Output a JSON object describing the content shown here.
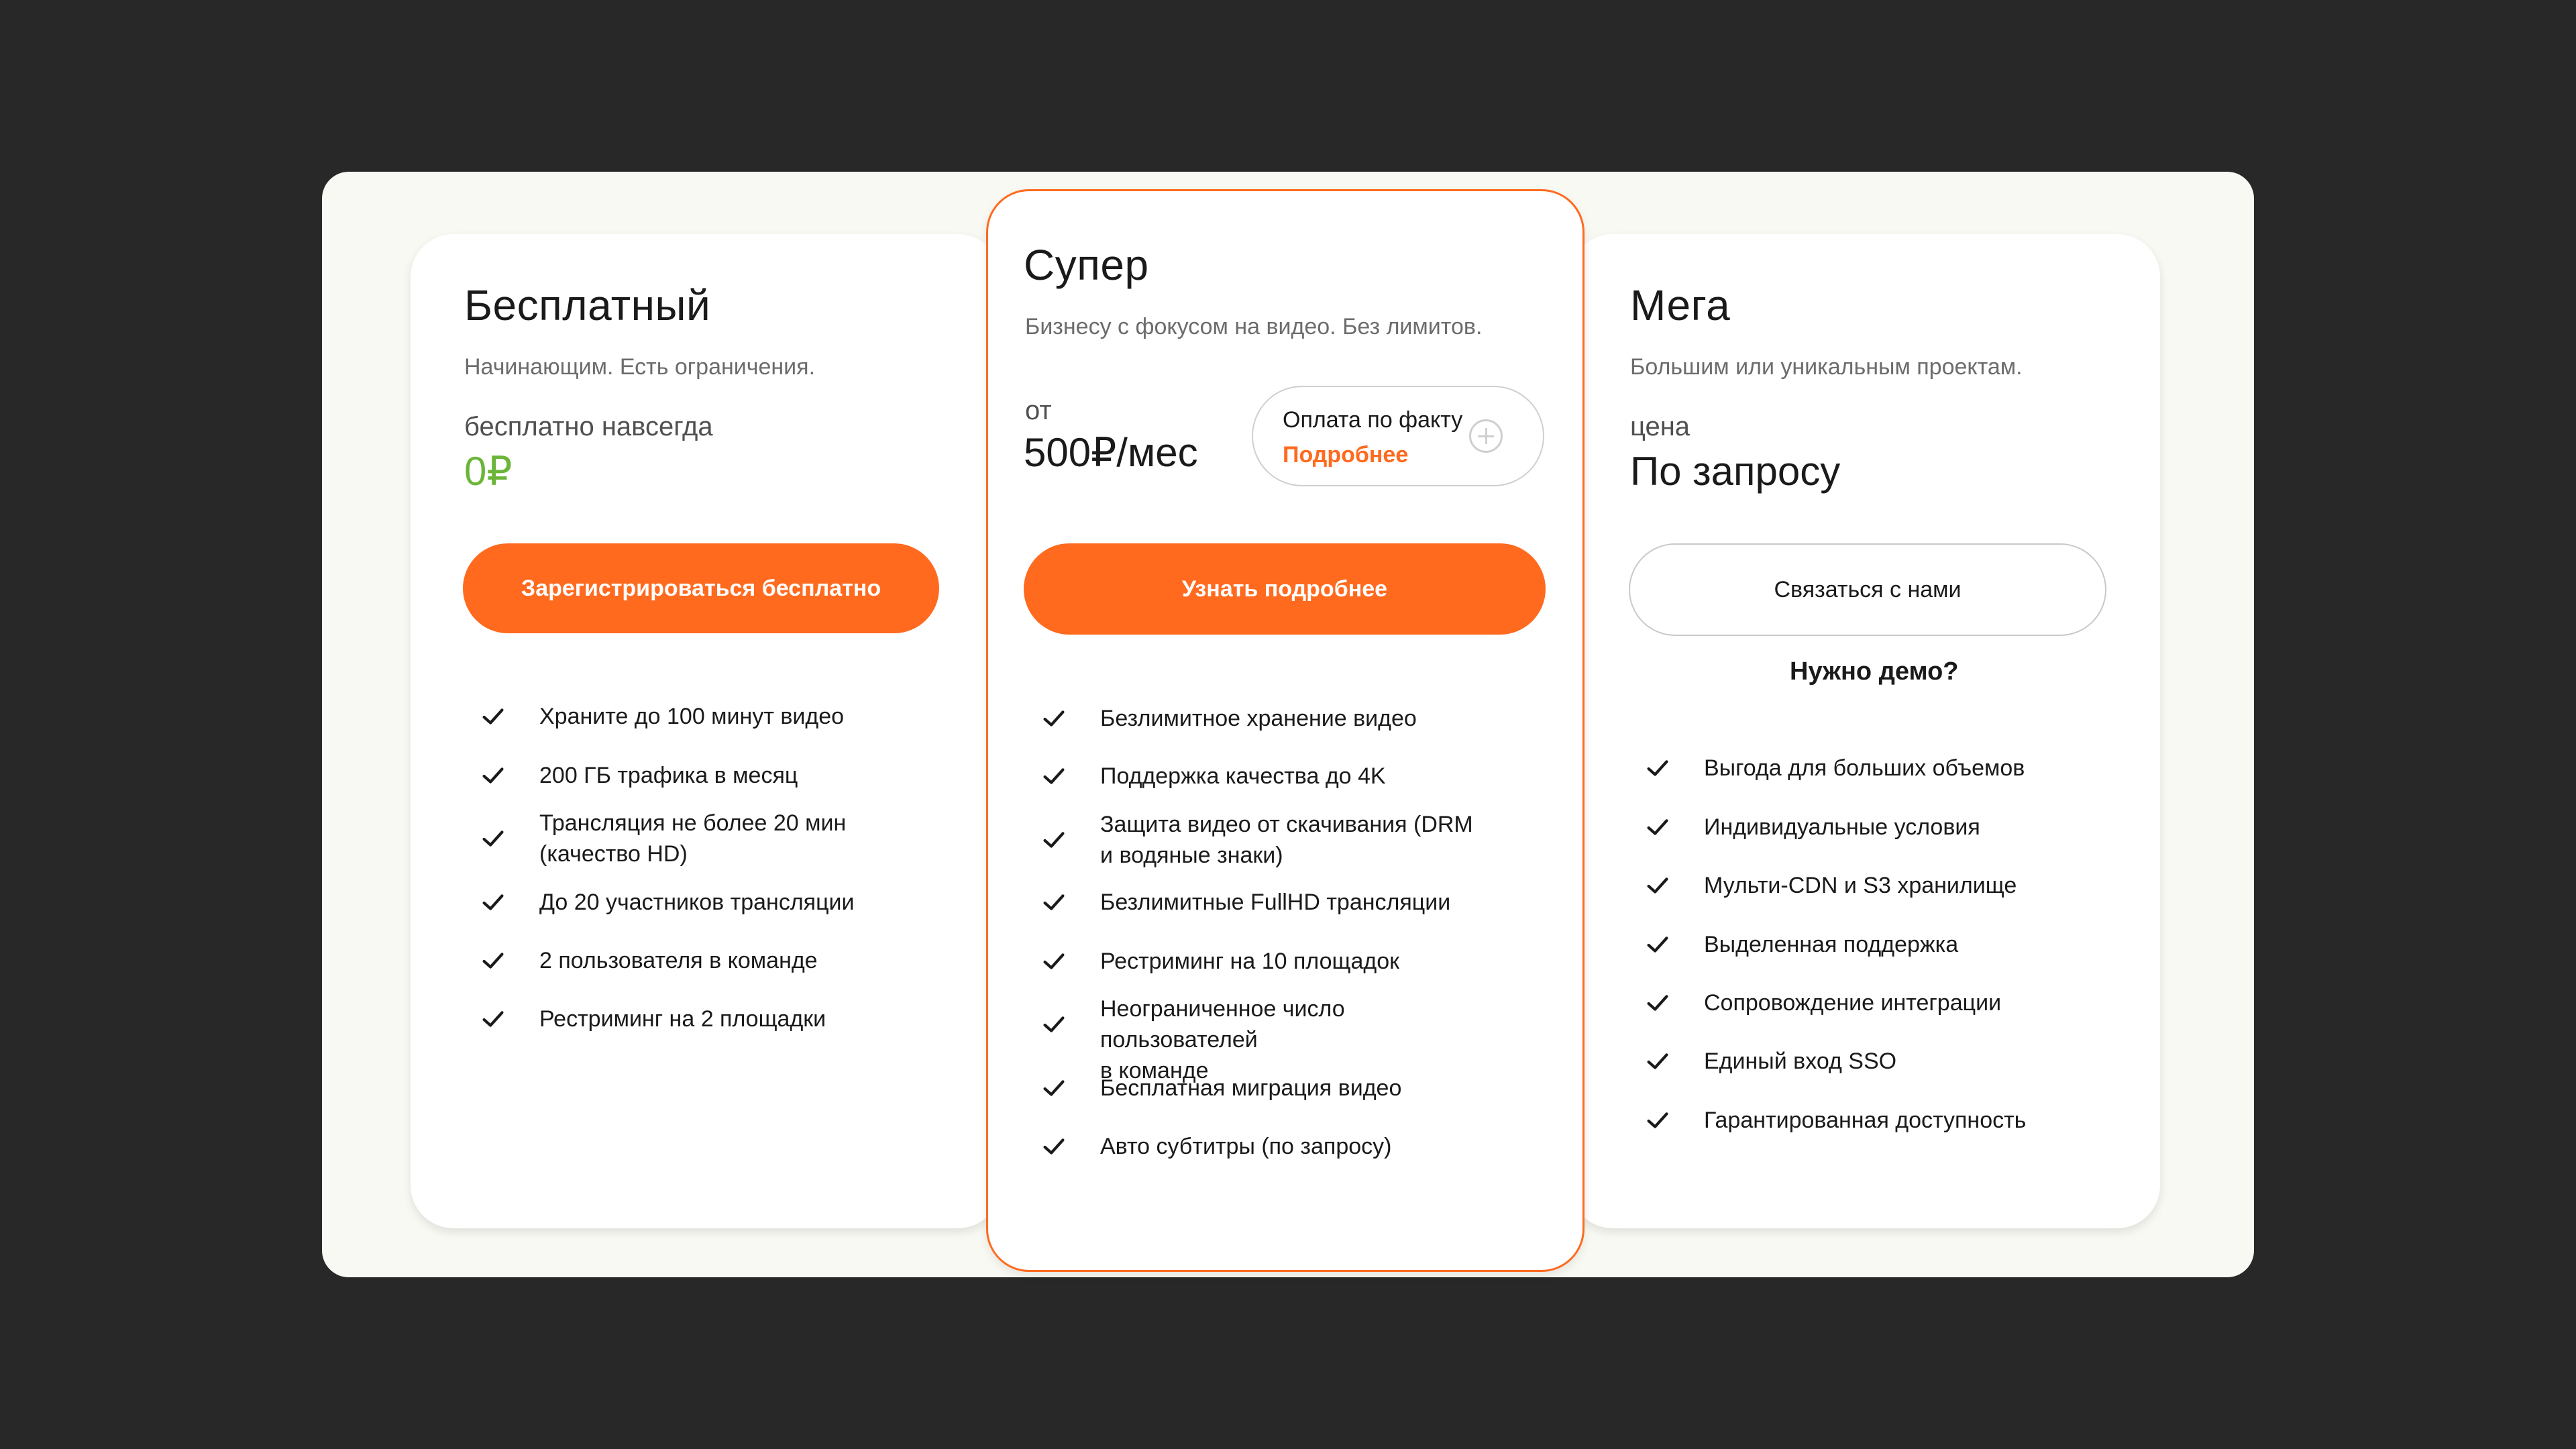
{
  "plans": {
    "free": {
      "title": "Бесплатный",
      "subtitle": "Начинающим. Есть ограничения.",
      "price_label": "бесплатно навсегда",
      "price": "0₽",
      "button": "Зарегистрироваться бесплатно",
      "features": [
        "Храните до 100 минут видео",
        "200 ГБ трафика в месяц",
        "Трансляция не более 20 мин\n(качество HD)",
        "До 20 участников трансляции",
        "2 пользователя в команде",
        "Рестриминг на 2 площадки"
      ]
    },
    "super": {
      "title": "Супер",
      "subtitle": "Бизнесу с фокусом на видео. Без лимитов.",
      "price_prefix": "от",
      "price": "500₽/мес",
      "pay_as_you_go": "Оплата по факту",
      "more_link": "Подробнее",
      "button": "Узнать подробнее",
      "features": [
        "Безлимитное хранение видео",
        "Поддержка качества до 4K",
        "Защита видео от скачивания (DRM\nи водяные знаки)",
        "Безлимитные FullHD трансляции",
        "Рестриминг на 10 площадок",
        "Неограниченное число пользователей\nв команде",
        "Бесплатная миграция видео",
        "Авто субтитры (по запросу)"
      ]
    },
    "mega": {
      "title": "Мега",
      "subtitle": "Большим или уникальным проектам.",
      "price_label": "цена",
      "price": "По запросу",
      "button": "Связаться с нами",
      "demo_link": "Нужно демо?",
      "features": [
        "Выгода для больших объемов",
        "Индивидуальные условия",
        "Мульти-CDN и S3 хранилище",
        "Выделенная поддержка",
        "Сопровождение интеграции",
        "Единый вход SSO",
        "Гарантированная доступность"
      ]
    }
  },
  "colors": {
    "accent": "#ff6a1f",
    "free_price": "#6bb53a",
    "background": "#282828",
    "panel": "#f9f9f3"
  },
  "icons": {
    "feature": "check-icon",
    "pill": "plus-circle-icon"
  }
}
